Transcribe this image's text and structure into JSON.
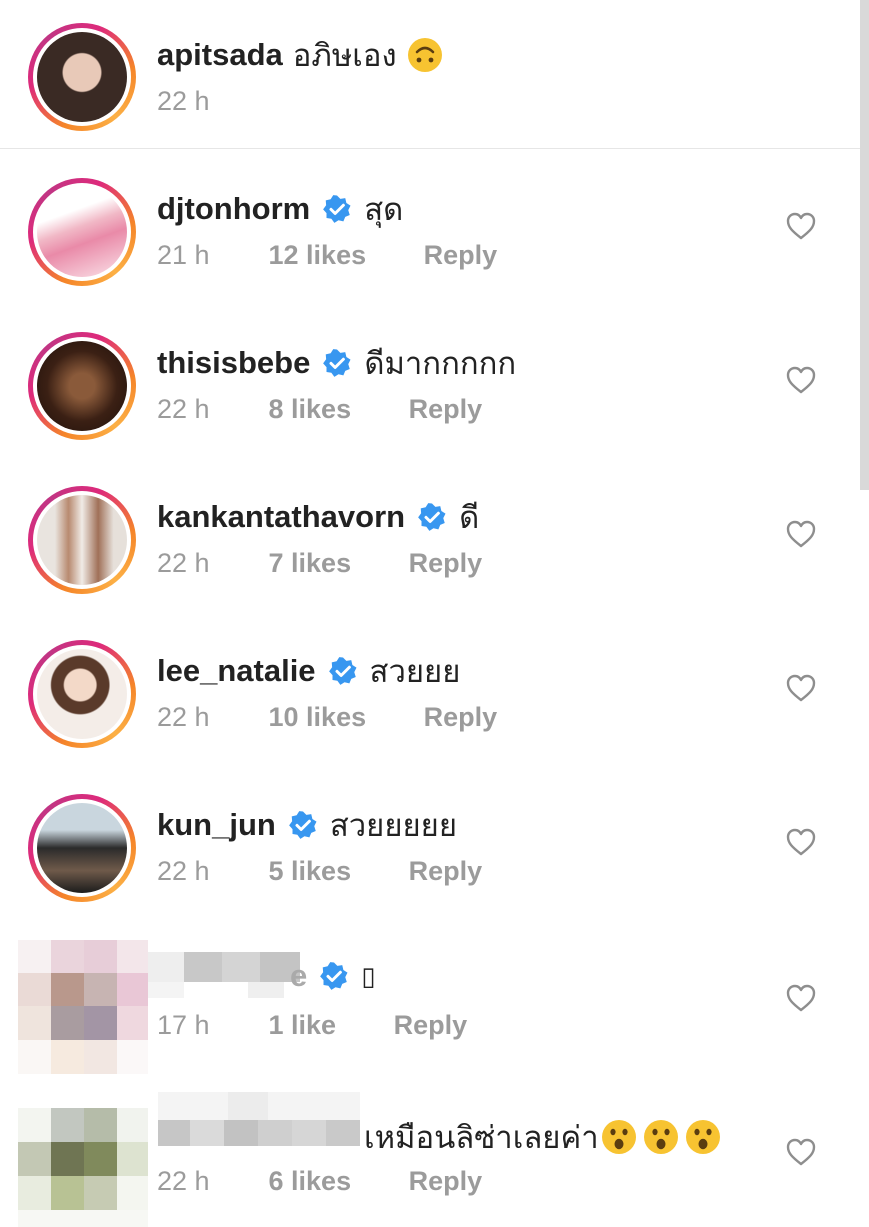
{
  "caption": {
    "username": "apitsada",
    "text": "อภิษเอง",
    "emoji": "upside-down-face",
    "time": "22 h"
  },
  "comments": [
    {
      "username": "djtonhorm",
      "verified": true,
      "text": "สุด",
      "time": "21 h",
      "likes": "12 likes",
      "reply": "Reply"
    },
    {
      "username": "thisisbebe",
      "verified": true,
      "text": "ดีมากกกกก",
      "time": "22 h",
      "likes": "8 likes",
      "reply": "Reply"
    },
    {
      "username": "kankantathavorn",
      "verified": true,
      "text": "ดี",
      "time": "22 h",
      "likes": "7 likes",
      "reply": "Reply"
    },
    {
      "username": "lee_natalie",
      "verified": true,
      "text": "สวยยย",
      "time": "22 h",
      "likes": "10 likes",
      "reply": "Reply"
    },
    {
      "username": "kun_jun",
      "verified": true,
      "text": "สวยยยยย",
      "time": "22 h",
      "likes": "5 likes",
      "reply": "Reply"
    },
    {
      "username": "e",
      "verified": true,
      "text": "▯",
      "time": "17 h",
      "likes": "1 like",
      "reply": "Reply"
    },
    {
      "username": "",
      "verified": false,
      "text": "เหมือนลิซ่าเลยค่า",
      "emojis": [
        "astonished-face",
        "astonished-face",
        "astonished-face"
      ],
      "time": "22 h",
      "likes": "6 likes",
      "reply": "Reply"
    }
  ],
  "colors": {
    "verified": "#3897f0",
    "meta_text": "#9b9b9b",
    "emoji_yellow": "#f7c331"
  }
}
